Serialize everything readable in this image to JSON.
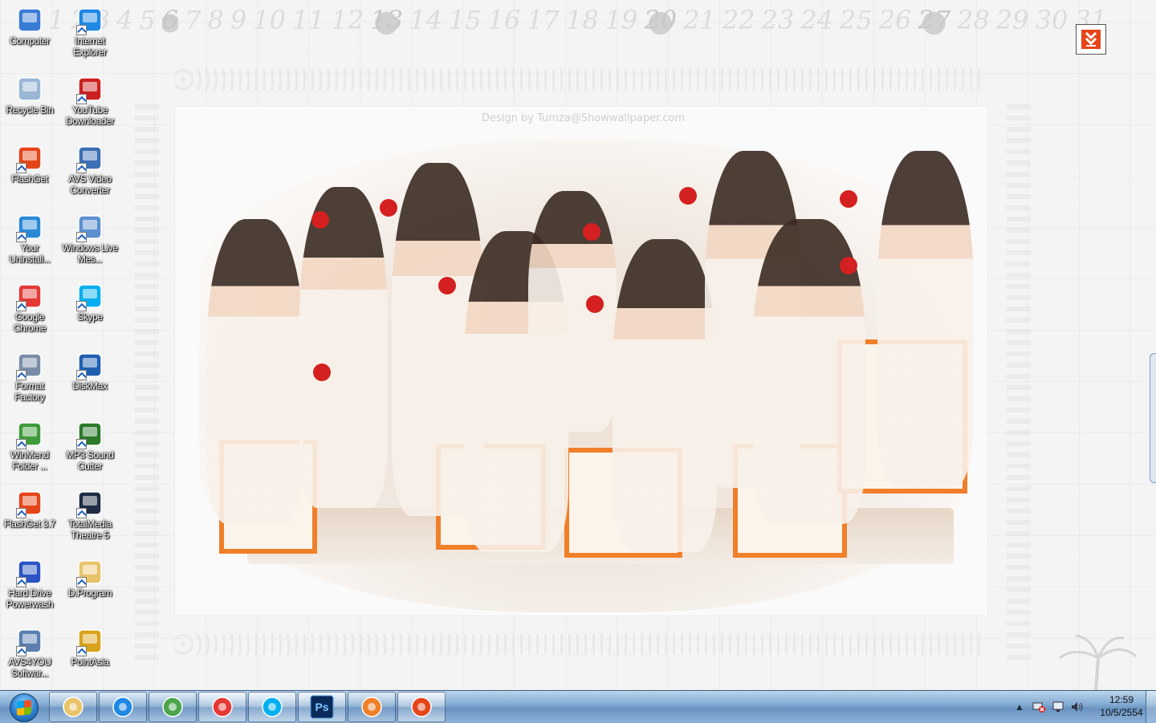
{
  "wallpaper": {
    "calendar_numbers": [
      "1",
      "2",
      "3",
      "4",
      "5",
      "6",
      "7",
      "8",
      "9",
      "10",
      "11",
      "12",
      "13",
      "14",
      "15",
      "16",
      "17",
      "18",
      "19",
      "20",
      "21",
      "22",
      "23",
      "24",
      "25",
      "26",
      "27",
      "28",
      "29",
      "30",
      "31"
    ],
    "highlighted_days": [
      "6",
      "13",
      "20",
      "27"
    ],
    "watermark": "Design by Tumza@Showwallpaper.com"
  },
  "desktop_icons": [
    {
      "label": "Computer",
      "icon": "computer-icon",
      "color": "#3a7bd5"
    },
    {
      "label": "Internet Explorer",
      "icon": "internet-explorer-icon",
      "color": "#1e88e5"
    },
    {
      "label": "Recycle Bin",
      "icon": "recycle-bin-icon",
      "color": "#9ab7d6"
    },
    {
      "label": "YouTube Downloader",
      "icon": "youtube-downloader-icon",
      "color": "#cc2020"
    },
    {
      "label": "FlashGet",
      "icon": "flashget-icon",
      "color": "#e5451a"
    },
    {
      "label": "AVS Video Converter",
      "icon": "avs-video-converter-icon",
      "color": "#3b6fb6"
    },
    {
      "label": "Your Uninstall...",
      "icon": "your-uninstaller-icon",
      "color": "#2a8ad8"
    },
    {
      "label": "Windows Live Mes...",
      "icon": "windows-live-messenger-icon",
      "color": "#5b8fcf"
    },
    {
      "label": "Google Chrome",
      "icon": "google-chrome-icon",
      "color": "#e53935"
    },
    {
      "label": "Skype",
      "icon": "skype-icon",
      "color": "#00aff0"
    },
    {
      "label": "Format Factory",
      "icon": "format-factory-icon",
      "color": "#7a8da8"
    },
    {
      "label": "DiskMax",
      "icon": "diskmax-icon",
      "color": "#1f5fb0"
    },
    {
      "label": "WinMend Folder ...",
      "icon": "winmend-folder-icon",
      "color": "#3f9b3a"
    },
    {
      "label": "MP3 Sound Cutter",
      "icon": "mp3-sound-cutter-icon",
      "color": "#2a7a2a"
    },
    {
      "label": "FlashGet 3.7",
      "icon": "flashget-3-7-icon",
      "color": "#e5451a"
    },
    {
      "label": "TotalMedia Theatre 5",
      "icon": "totalmedia-theatre-icon",
      "color": "#1d2b44"
    },
    {
      "label": "Hard Drive Powerwash",
      "icon": "hard-drive-powerwash-icon",
      "color": "#2b54c4"
    },
    {
      "label": "D.Program",
      "icon": "dprogram-folder-icon",
      "color": "#e8c36a"
    },
    {
      "label": "AVS4YOU Softwar...",
      "icon": "avs4you-icon",
      "color": "#5a7fb0"
    },
    {
      "label": "PointAsia",
      "icon": "pointasia-icon",
      "color": "#d8a21a"
    }
  ],
  "taskbar": {
    "buttons": [
      {
        "name": "windows-explorer",
        "icon": "folder-icon",
        "color": "#e8c36a",
        "active": false
      },
      {
        "name": "internet-explorer",
        "icon": "internet-explorer-icon",
        "color": "#1e88e5",
        "active": false
      },
      {
        "name": "windows-live-messenger",
        "icon": "messenger-icon",
        "color": "#4ca64c",
        "active": false
      },
      {
        "name": "google-chrome",
        "icon": "google-chrome-icon",
        "color": "#e53935",
        "active": true
      },
      {
        "name": "skype",
        "icon": "skype-icon",
        "color": "#00aff0",
        "active": true
      },
      {
        "name": "photoshop",
        "icon": "photoshop-icon",
        "color": "#0a2a5a",
        "active": true,
        "text": "Ps"
      },
      {
        "name": "media-player",
        "icon": "media-player-icon",
        "color": "#f07f2a",
        "active": false
      },
      {
        "name": "flashget",
        "icon": "flashget-icon",
        "color": "#e5451a",
        "active": true
      }
    ],
    "tray": {
      "icons": [
        "show-hidden-icons-icon",
        "network-error-icon",
        "action-center-icon",
        "volume-icon"
      ],
      "time": "12:59",
      "date": "10/5/2554"
    }
  },
  "colors": {
    "taskbar_top": "#bcd5ec",
    "taskbar_bottom": "#6893c1",
    "accent_orange": "#f07f2a"
  }
}
